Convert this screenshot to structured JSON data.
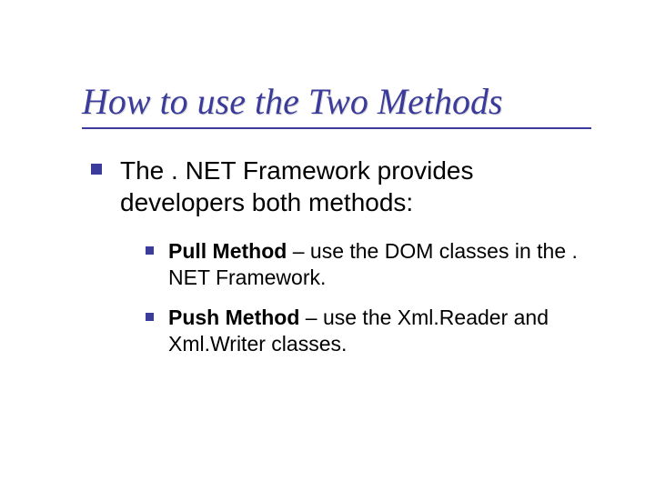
{
  "title": "How to use the Two Methods",
  "main_point": "The . NET Framework provides developers both methods:",
  "sub_points": [
    {
      "label": "Pull Method",
      "desc": " – use the DOM classes in the . NET Framework."
    },
    {
      "label": "Push Method",
      "desc": " – use the Xml.Reader and Xml.Writer classes."
    }
  ]
}
